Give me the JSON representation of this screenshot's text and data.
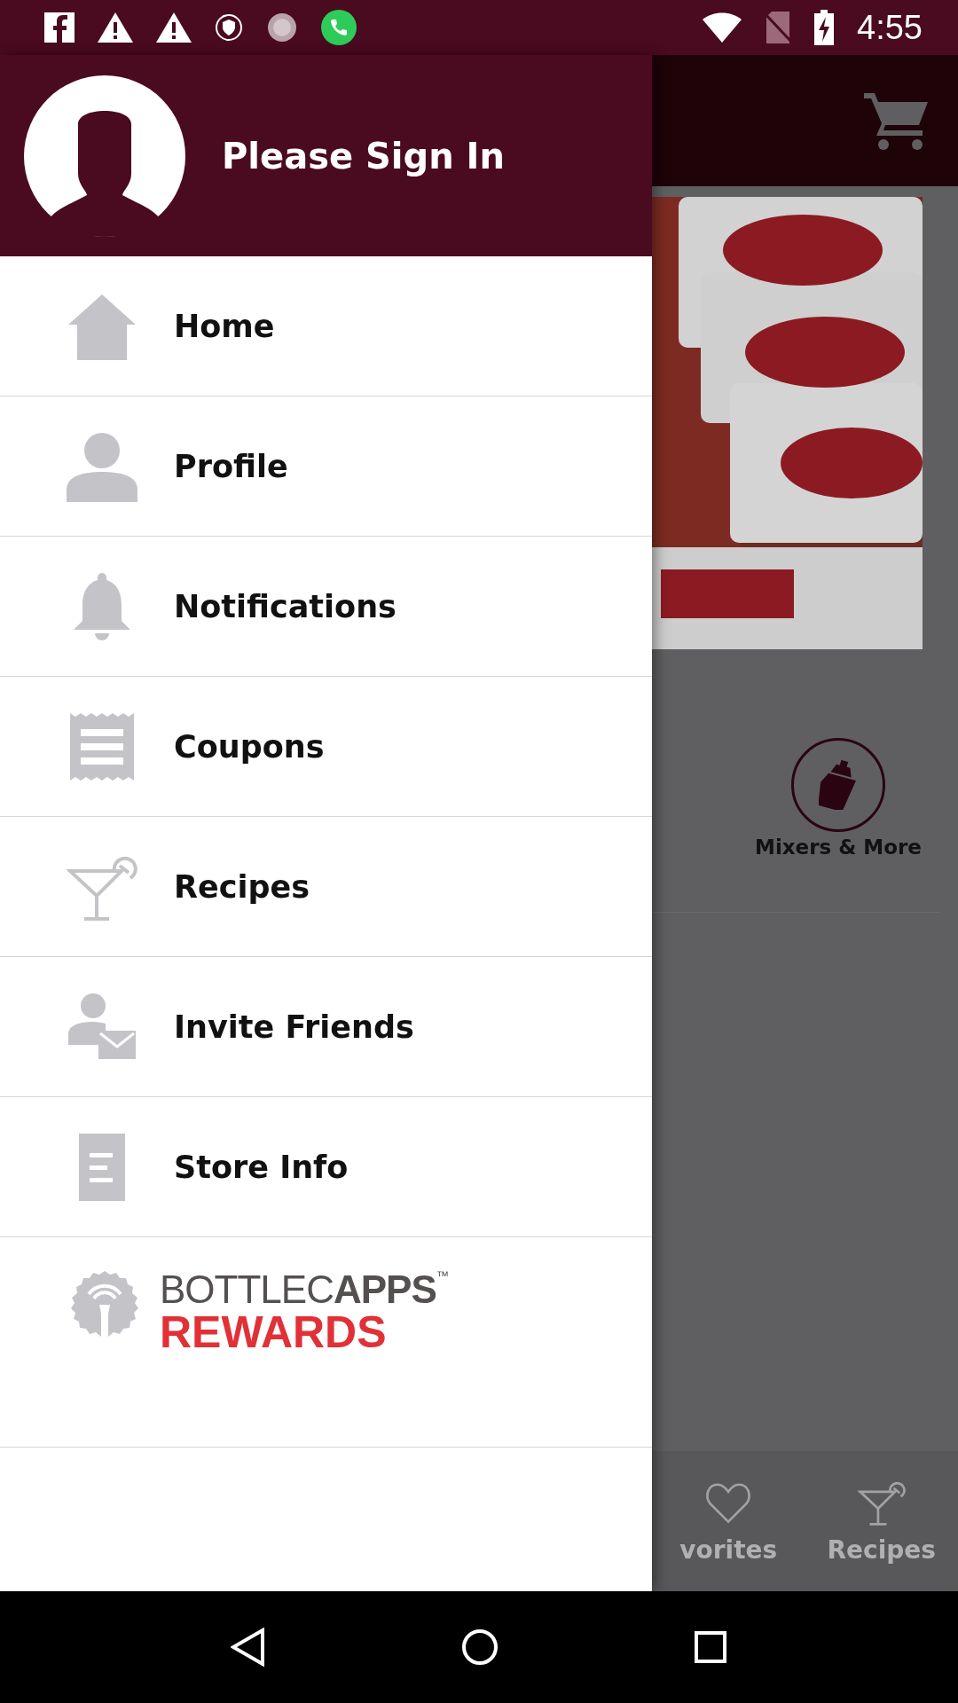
{
  "status_bar": {
    "time": "4:55"
  },
  "drawer": {
    "header": {
      "title": "Please Sign In"
    },
    "items": [
      {
        "label": "Home",
        "kind": "home"
      },
      {
        "label": "Profile",
        "kind": "person"
      },
      {
        "label": "Notifications",
        "kind": "bell"
      },
      {
        "label": "Coupons",
        "kind": "receipt"
      },
      {
        "label": "Recipes",
        "kind": "cocktail"
      },
      {
        "label": "Invite Friends",
        "kind": "invite"
      },
      {
        "label": "Store Info",
        "kind": "document"
      }
    ],
    "logo": {
      "brand": "BOTTLEC**APPS**$^{™}$",
      "tagline": "REWARDS"
    }
  },
  "background": {
    "category": {
      "label": "Mixers & More"
    },
    "bottom_tabs": [
      {
        "label": "vorites",
        "kind": "heart"
      },
      {
        "label": "Recipes",
        "kind": "cocktail"
      }
    ]
  }
}
